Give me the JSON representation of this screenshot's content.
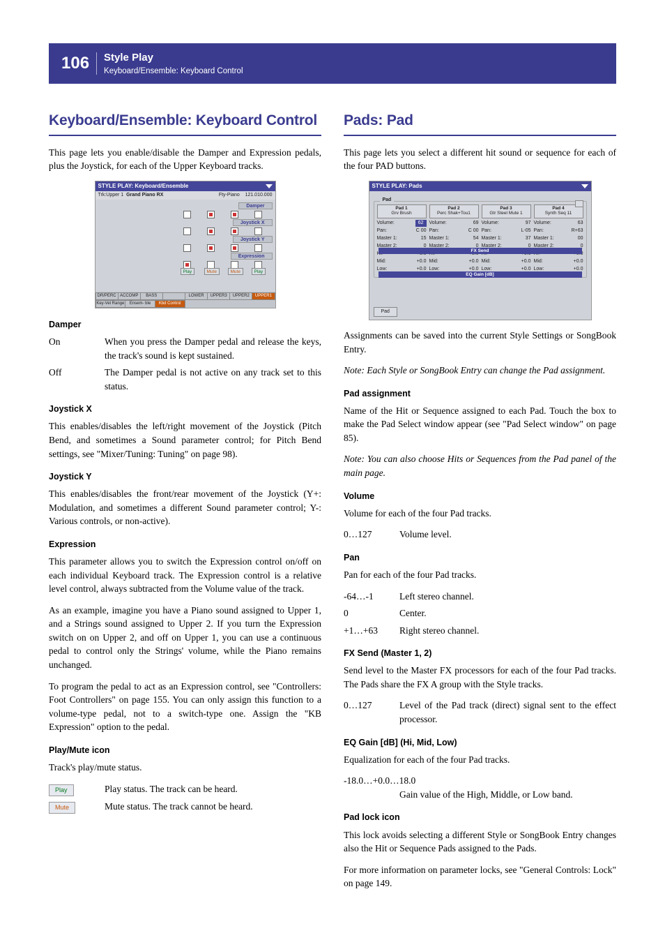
{
  "header": {
    "page_num": "106",
    "title": "Style Play",
    "sub": "Keyboard/Ensemble: Keyboard Control"
  },
  "left": {
    "section_title": "Keyboard/Ensemble: Keyboard Control",
    "intro": "This page lets you enable/disable the Damper and Expression pedals, plus the Joystick, for each of the Upper Keyboard tracks.",
    "screenshot": {
      "title": "STYLE PLAY: Keyboard/Ensemble",
      "trk_line_left": "Trk:Upper 1",
      "trk_line_mid": "Grand Piano RX",
      "trk_line_r1": "Fty-Piano",
      "trk_line_r2": "121.010.000",
      "rows": [
        "Damper",
        "Joystick X",
        "Joystick Y",
        "Expression"
      ],
      "btns": [
        "Play",
        "Mute",
        "Mute",
        "Play"
      ],
      "bottom_row1": [
        "DR/PERC",
        "ACCOMP",
        "BASS",
        "",
        "LOWER",
        "UPPER3",
        "UPPER2",
        "UPPER1"
      ],
      "bottom_row2": [
        "Key-Vel\nRange",
        "Ensem-\nble",
        "Kbd\nControl"
      ]
    },
    "damper": {
      "head": "Damper",
      "on_label": "On",
      "on_text": "When you press the Damper pedal and release the keys, the track's sound is kept sustained.",
      "off_label": "Off",
      "off_text": "The Damper pedal is not active on any track set to this status."
    },
    "joyx": {
      "head": "Joystick X",
      "text": "This enables/disables the left/right movement of the Joystick (Pitch Bend, and sometimes a Sound parameter control; for Pitch Bend settings, see \"Mixer/Tuning: Tuning\" on page 98)."
    },
    "joyy": {
      "head": "Joystick Y",
      "text": "This enables/disables the front/rear movement of the Joystick (Y+: Modulation, and sometimes a different Sound parameter control; Y-: Various controls, or non-active)."
    },
    "expr": {
      "head": "Expression",
      "p1": "This parameter allows you to switch the Expression control on/off on each individual Keyboard track. The Expression control is a relative level control, always subtracted from the Volume value of the track.",
      "p2": "As an example, imagine you have a Piano sound assigned to Upper 1, and a Strings sound assigned to Upper 2. If you turn the Expression switch on on Upper 2, and off on Upper 1, you can use a continuous pedal to control only the Strings' volume, while the Piano remains unchanged.",
      "p3": "To program the pedal to act as an Expression control, see \"Controllers: Foot Controllers\" on page 155. You can only assign this function to a volume-type pedal, not to a switch-type one. Assign the \"KB Expression\" option to the pedal."
    },
    "pm": {
      "head": "Play/Mute icon",
      "intro": "Track's play/mute status.",
      "play_label": "Play",
      "play_text": "Play status. The track can be heard.",
      "mute_label": "Mute",
      "mute_text": "Mute status. The track cannot be heard."
    }
  },
  "right": {
    "section_title": "Pads: Pad",
    "intro": "This page lets you select a different hit sound or sequence for each of the four PAD buttons.",
    "screenshot": {
      "title": "STYLE PLAY: Pads",
      "legend": "Pad",
      "tab": "Pad",
      "cols": [
        {
          "name": "Pad 1",
          "sound": "Grv Brush",
          "vol": "62",
          "pan": "C 00",
          "m1": "15",
          "m2": "0",
          "hi": "+0.0",
          "mid": "+0.0",
          "low": "+0.0"
        },
        {
          "name": "Pad 2",
          "sound": "Perc Shak+Tou1",
          "vol": "69",
          "pan": "C 00",
          "m1": "54",
          "m2": "0",
          "hi": "+0.0",
          "mid": "+0.0",
          "low": "+0.0"
        },
        {
          "name": "Pad 3",
          "sound": "Gtr Steel Mute 1",
          "vol": "97",
          "pan": "L-05",
          "m1": "37",
          "m2": "0",
          "hi": "+0.0",
          "mid": "+0.0",
          "low": "+0.0"
        },
        {
          "name": "Pad 4",
          "sound": "Synth Seq 11",
          "vol": "63",
          "pan": "R+63",
          "m1": "00",
          "m2": "0",
          "hi": "+0.0",
          "mid": "+0.0",
          "low": "+0.0"
        }
      ],
      "labels": {
        "vol": "Volume:",
        "pan": "Pan:",
        "m1": "Master 1:",
        "m2": "Master 2:",
        "hi": "Hi:",
        "mid": "Mid:",
        "low": "Low:"
      },
      "band_fx": "FX Send",
      "band_eq": "EQ Gain [dB]"
    },
    "after_ss": "Assignments can be saved into the current Style Settings or SongBook Entry.",
    "note1": "Note: Each Style or SongBook Entry can change the Pad assignment.",
    "padassign": {
      "head": "Pad assignment",
      "p1": "Name of the Hit or Sequence assigned to each Pad. Touch the box to make the Pad Select window appear (see \"Pad Select window\" on page 85).",
      "note": "Note: You can also choose Hits or Sequences from the Pad panel of the main page."
    },
    "volume": {
      "head": "Volume",
      "p": "Volume for each of the four Pad tracks.",
      "range": "0…127",
      "text": "Volume level."
    },
    "pan": {
      "head": "Pan",
      "p": "Pan for each of the four Pad tracks.",
      "r1l": "-64…-1",
      "r1t": "Left stereo channel.",
      "r2l": "0",
      "r2t": "Center.",
      "r3l": "+1…+63",
      "r3t": "Right stereo channel."
    },
    "fx": {
      "head": "FX Send (Master 1, 2)",
      "p": "Send level to the Master FX processors for each of the four Pad tracks. The Pads share the FX A group with the Style tracks.",
      "range": "0…127",
      "text": "Level of the Pad track (direct) signal sent to the effect processor."
    },
    "eq": {
      "head": "EQ Gain [dB] (Hi, Mid, Low)",
      "p": "Equalization for each of the four Pad tracks.",
      "range": "-18.0…+0.0…18.0",
      "text": "Gain value of the High, Middle, or Low band."
    },
    "lock": {
      "head": "Pad lock icon",
      "p1": "This lock avoids selecting a different Style or SongBook Entry changes also the Hit or Sequence Pads assigned to the Pads.",
      "p2": "For more information on parameter locks, see \"General Controls: Lock\" on page 149."
    }
  }
}
